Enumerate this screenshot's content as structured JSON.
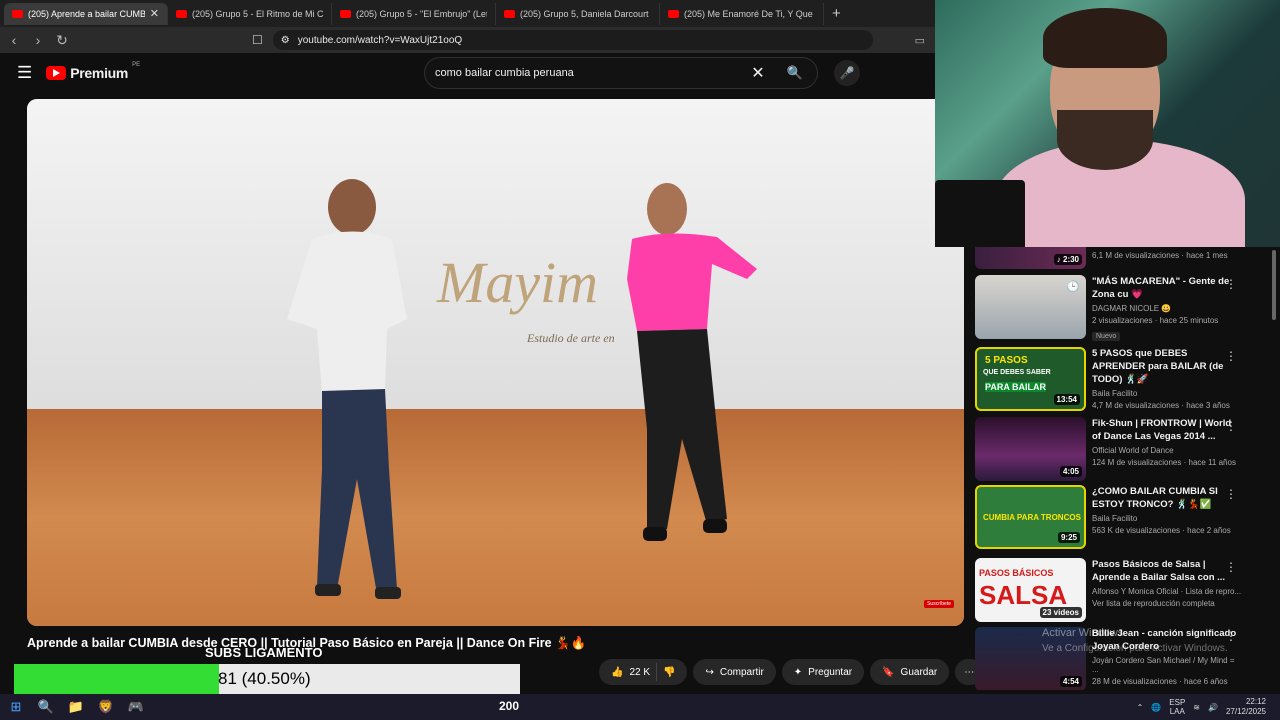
{
  "browser": {
    "tabs": [
      {
        "label": "(205) Aprende a bailar CUMBIA d",
        "active": true
      },
      {
        "label": "(205) Grupo 5 - El Ritmo de Mi Coraz",
        "active": false
      },
      {
        "label": "(205) Grupo 5 - \"El Embrujo\" (Letra)",
        "active": false
      },
      {
        "label": "(205) Grupo 5, Daniela Darcourt - Qu",
        "active": false
      },
      {
        "label": "(205) Me Enamoré De Ti, Y Que - You",
        "active": false
      }
    ],
    "new_tab_icon": "+",
    "url": "youtube.com/watch?v=WaxUjt21ooQ"
  },
  "youtube": {
    "logo_text": "Premium",
    "region": "PE",
    "search_value": "como bailar cumbia peruana"
  },
  "video": {
    "studio_text": "Mayim",
    "studio_sub": "Estudio de arte en",
    "subscribe_badge": "Suscríbete",
    "title": "Aprende a bailar CUMBIA desde CERO || Tutorial Paso Básico en Pareja || Dance On Fire 💃🔥",
    "likes": "22 K",
    "share_label": "Compartir",
    "ask_label": "Preguntar",
    "save_label": "Guardar"
  },
  "overlay": {
    "subs_label": "SUBS LIGAMENTO",
    "subs_value": "81 (40.50%)",
    "subs_progress": 0.405,
    "goal_count": "200"
  },
  "sidebar": {
    "items": [
      {
        "title": "",
        "channel": "",
        "stats": "6,1 M de visualizaciones · hace 1 mes",
        "duration": "♪ 2:30",
        "badge": ""
      },
      {
        "title": "\"MÁS MACARENA\" - Gente de Zona cu 💗",
        "channel": "DAGMAR NICOLE 😀",
        "stats": "2 visualizaciones · hace 25 minutos",
        "duration": "",
        "badge": "Nuevo"
      },
      {
        "title": "5 PASOS que DEBES APRENDER para BAILAR (de TODO) 🕺🚀",
        "channel": "Baila Facilito",
        "stats": "4,7 M de visualizaciones · hace 3 años",
        "duration": "13:54",
        "badge": ""
      },
      {
        "title": "Fik-Shun | FRONTROW | World of Dance Las Vegas 2014 ...",
        "channel": "Official World of Dance",
        "stats": "124 M de visualizaciones · hace 11 años",
        "duration": "4:05",
        "badge": ""
      },
      {
        "title": "¿COMO BAILAR CUMBIA SI ESTOY TRONCO? 🕺💃✅",
        "channel": "Baila Facilito",
        "stats": "563 K de visualizaciones · hace 2 años",
        "duration": "9:25",
        "badge": ""
      },
      {
        "title": "Pasos Básicos de Salsa | Aprende a Bailar Salsa con ...",
        "channel": "Alfonso Y Monica Oficial · Lista de repro...",
        "stats": "Ver lista de reproducción completa",
        "duration": "23 videos",
        "badge": ""
      },
      {
        "title": "Billie Jean - canción significado Joyan Cordero",
        "channel": "Joyán Cordero San Michael / My Mind = ...",
        "stats": "28 M de visualizaciones · hace 6 años",
        "duration": "4:54",
        "badge": ""
      }
    ],
    "thumb_texts": {
      "pasos": "5 PASOS",
      "pasos_sub": "QUE DEBES SABER",
      "pasos_sub2": "PARA BAILAR",
      "troncos": "CUMBIA PARA TRONCOS",
      "salsa_top": "PASOS BÁSICOS",
      "salsa": "SALSA"
    }
  },
  "windows": {
    "activate_title": "Activar Windows",
    "activate_sub": "Ve a Configuración para activar Windows.",
    "lang_top": "ESP",
    "lang_bottom": "LAA",
    "time": "22:12",
    "date": "27/12/2025"
  },
  "colors": {
    "yt_red": "#ff0000",
    "progress_green": "#33dd33",
    "bg": "#0f0f0f"
  }
}
